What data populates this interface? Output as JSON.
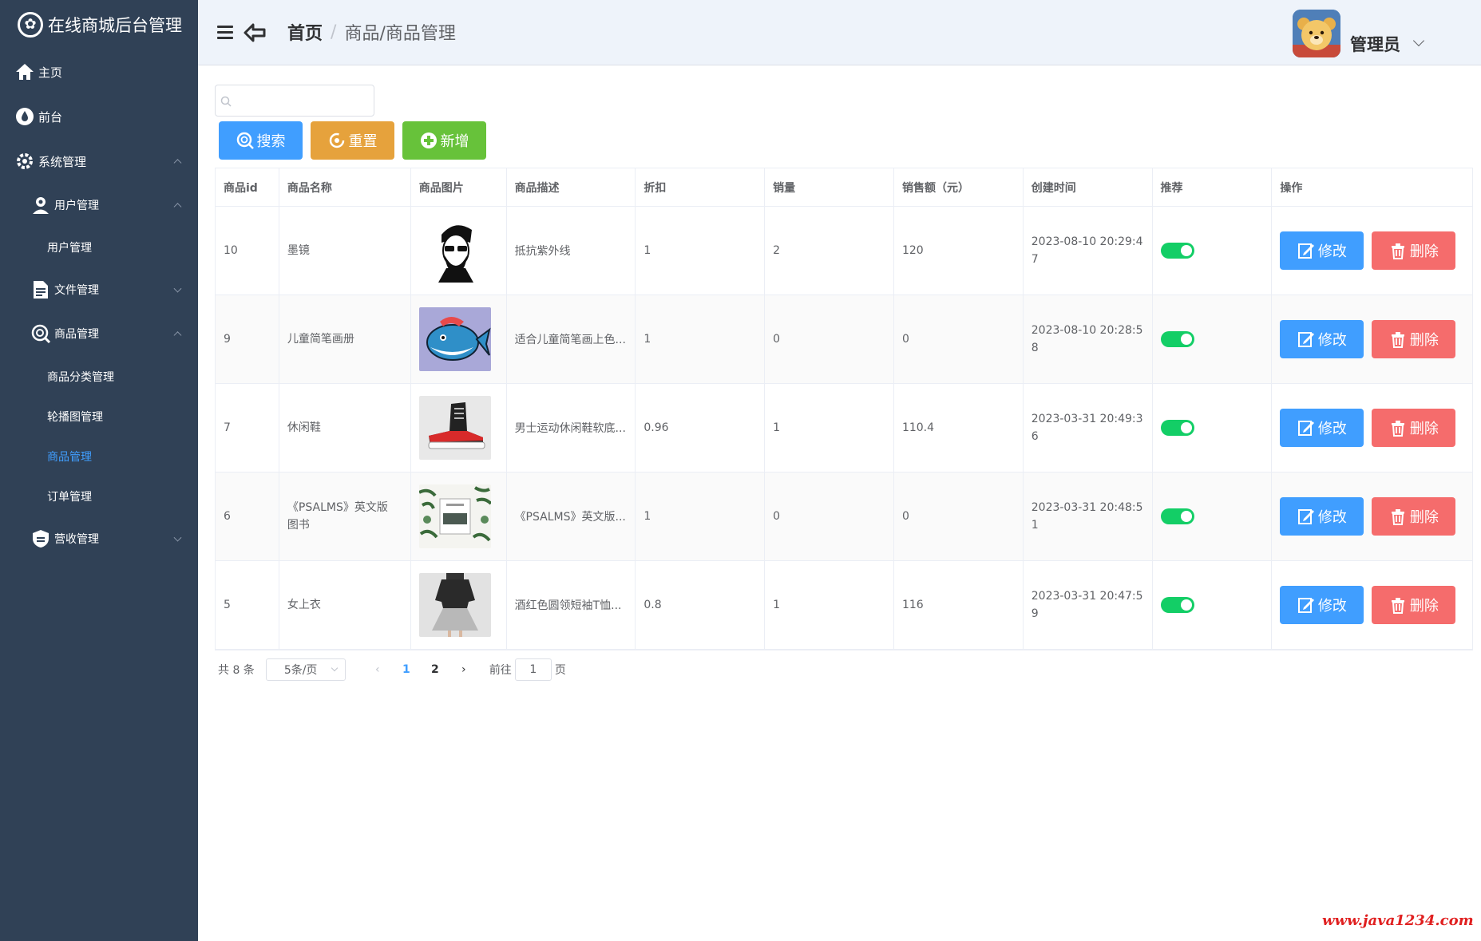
{
  "app": {
    "title": "在线商城后台管理"
  },
  "sidebar": {
    "items": [
      {
        "label": "主页"
      },
      {
        "label": "前台"
      },
      {
        "label": "系统管理"
      },
      {
        "label": "用户管理"
      },
      {
        "label": "用户管理"
      },
      {
        "label": "文件管理"
      },
      {
        "label": "商品管理"
      },
      {
        "label": "商品分类管理"
      },
      {
        "label": "轮播图管理"
      },
      {
        "label": "商品管理"
      },
      {
        "label": "订单管理"
      },
      {
        "label": "营收管理"
      }
    ]
  },
  "header": {
    "breadcrumb_home": "首页",
    "breadcrumb_sep": "/",
    "breadcrumb_current": "商品/商品管理",
    "user_name": "管理员"
  },
  "toolbar": {
    "search_placeholder": "",
    "search_label": "搜索",
    "reset_label": "重置",
    "add_label": "新增"
  },
  "table": {
    "columns": [
      "商品id",
      "商品名称",
      "商品图片",
      "商品描述",
      "折扣",
      "销量",
      "销售额（元）",
      "创建时间",
      "推荐",
      "操作"
    ],
    "rows": [
      {
        "id": "10",
        "name": "墨镜",
        "desc": "抵抗紫外线",
        "discount": "1",
        "sales": "2",
        "revenue": "120",
        "created": "2023-08-10 20:29:47",
        "recommend": true,
        "image": "man-sunglasses"
      },
      {
        "id": "9",
        "name": "儿童简笔画册",
        "desc": "适合儿童简笔画上色...",
        "discount": "1",
        "sales": "0",
        "revenue": "0",
        "created": "2023-08-10 20:28:58",
        "recommend": true,
        "image": "whale-drawing"
      },
      {
        "id": "7",
        "name": "休闲鞋",
        "desc": "男士运动休闲鞋软底...",
        "discount": "0.96",
        "sales": "1",
        "revenue": "110.4",
        "created": "2023-03-31 20:49:36",
        "recommend": true,
        "image": "sneaker"
      },
      {
        "id": "6",
        "name": "《PSALMS》英文版 图书",
        "desc": "《PSALMS》英文版...",
        "discount": "1",
        "sales": "0",
        "revenue": "0",
        "created": "2023-03-31 20:48:51",
        "recommend": true,
        "image": "book-leaves"
      },
      {
        "id": "5",
        "name": "女上衣",
        "desc": "酒红色圆领短袖T恤...",
        "discount": "0.8",
        "sales": "1",
        "revenue": "116",
        "created": "2023-03-31 20:47:59",
        "recommend": true,
        "image": "woman-top"
      }
    ],
    "edit_label": "修改",
    "delete_label": "删除"
  },
  "pagination": {
    "total": "共 8 条",
    "page_size": "5条/页",
    "pages": [
      "1",
      "2"
    ],
    "current": "1",
    "goto_label": "前往",
    "goto_value": "1",
    "page_suffix": "页"
  },
  "watermark": "www.java1234.com",
  "colors": {
    "sidebar": "#304156",
    "primary": "#409eff",
    "warning": "#e6a23c",
    "success": "#67c23a",
    "danger": "#f56c6c",
    "switch_on": "#13ce66"
  }
}
